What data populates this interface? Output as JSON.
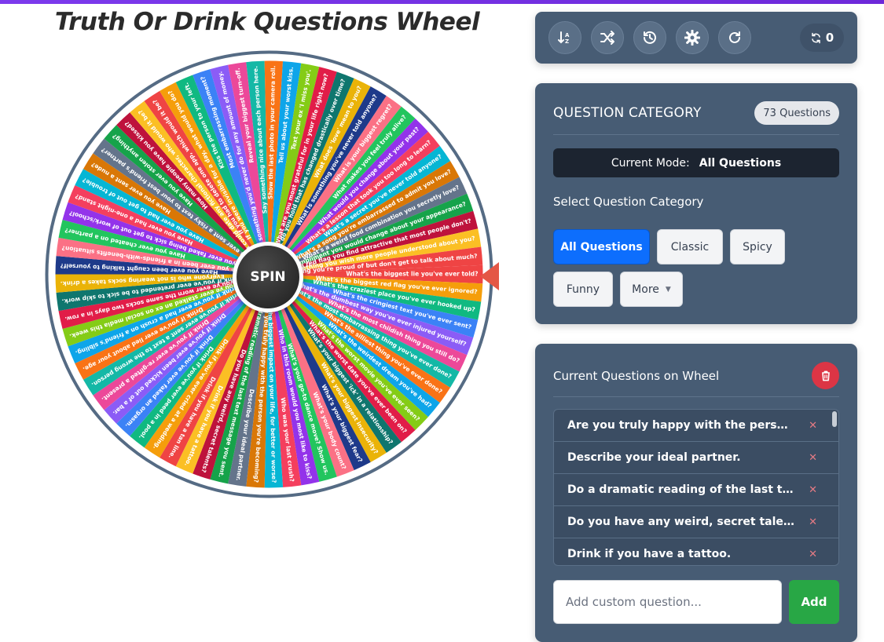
{
  "title": "Truth Or Drink Questions Wheel",
  "spin_label": "SPIN",
  "toolbar": {
    "buttons": [
      {
        "name": "sort-icon"
      },
      {
        "name": "shuffle-icon"
      },
      {
        "name": "history-icon"
      },
      {
        "name": "settings-icon"
      },
      {
        "name": "redo-icon"
      }
    ],
    "spin_count": "0"
  },
  "category_panel": {
    "title": "QUESTION CATEGORY",
    "question_count": "73 Questions",
    "mode_label": "Current Mode:",
    "mode_value": "All Questions",
    "select_label": "Select Question Category",
    "chips": [
      "All Questions",
      "Classic",
      "Spicy",
      "Funny",
      "More"
    ],
    "active_chip": "All Questions"
  },
  "current_panel": {
    "title": "Current Questions on Wheel",
    "questions": [
      "Are you truly happy with the person you're with?",
      "Describe your ideal partner.",
      "Do a dramatic reading of the last text you sent.",
      "Do you have any weird, secret talents?",
      "Drink if you have a tattoo."
    ],
    "input_placeholder": "Add custom question...",
    "add_label": "Add"
  },
  "wheel": {
    "colors": [
      "#ef4444",
      "#f59e0b",
      "#10b981",
      "#3b82f6",
      "#8b5cf6",
      "#ec4899",
      "#14b8a6",
      "#f97316",
      "#0ea5e9",
      "#84cc16",
      "#e11d48",
      "#0f766e",
      "#eab308",
      "#1e3a8a",
      "#fb7185",
      "#22c55e",
      "#9333ea",
      "#f43f5e",
      "#06b6d4",
      "#d97706",
      "#64748b",
      "#16a34a",
      "#be123c",
      "#fbbf24"
    ],
    "rim_color": "#556b84",
    "segments": [
      "What's the biggest lie you've ever told?",
      "What's the biggest red flag you've ever ignored?",
      "What's the craziest place you've ever hooked up?",
      "What's the cringiest text you've ever sent?",
      "What's the dumbest way you've ever injured yourself?",
      "What's the most childish thing you still do?",
      "What's the most embarrassing thing you've ever done?",
      "What's the silliest thing you've ever done?",
      "What's the weirdest dream you've had?",
      "What's the worst movie you've ever seen?",
      "What's the worst date you've ever been on?",
      "What's your biggest 'ick' in a relationship?",
      "What's your biggest insecurity?",
      "What's your biggest fear?",
      "What's your body count?",
      "What's your go-to dance move? Show us.",
      "Who in this room would you most like to kiss?",
      "Who was your last crush?",
      "Who's had the biggest impact on your life, for better or worse?",
      "Are you truly happy with the person you're becoming?",
      "Describe your ideal partner.",
      "Do a dramatic reading of the last text message you sent.",
      "Do you have any weird, secret talents?",
      "Drink if you have a tattoo.",
      "Drink if you have a tan line.",
      "Drink if you've ever cried at a wedding.",
      "Drink if you've ever peed in a pool.",
      "Drink if you've ever faked an orgasm.",
      "Drink if you've ever been kicked out of a bar.",
      "Drink if you've ever re-gifted a present.",
      "Drink if you've ever sent a text to the wrong person.",
      "Drink if you've ever lied about your age.",
      "Drink if you've ever had a crush on a friend's sibling.",
      "Drink if you've ever stalked an ex on social media this week.",
      "Drink if you've ever worn the same socks two days in a row.",
      "Drink if you've ever pretended to be sick to skip work.",
      "Everyone who is not wearing socks takes a drink.",
      "Have you ever been caught talking to yourself?",
      "Have you ever been in a friends-with-benefits situation?",
      "Have you ever cheated on a partner?",
      "Have you ever faked being sick to get out of work/school?",
      "Have you ever had a one-night stand?",
      "Have you ever had to get out of trouble?",
      "Have you ever sent a nude?",
      "Have you ever sent a risky text to your best friend's partner?",
      "Have you ever stolen anything?",
      "How many people have you kissed?",
      "If you could date any fictional character, who would it be?",
      "If you had to delete one app, which would it be?",
      "If you were invisible for a day, what would you do?",
      "Kiss the person to your left.",
      "Most embarrassing moment?",
      "Name something you'd never do for any amount of money.",
      "Reveal your biggest turn-off.",
      "Say something nice about each person here.",
      "Show the last photo in your camera roll.",
      "Tell us about your worst kiss.",
      "Text your ex 'I miss you'.",
      "What are you most grateful for in your life right now?",
      "What do you hold that has changed drastically over time?",
      "What does 'love' mean to you?",
      "What is something you've never told anyone?",
      "What is your biggest regret?",
      "What makes you feel truly alive?",
      "What would you change about your past?",
      "What's a lesson that took you too long to learn?",
      "What's a secret you've never told anyone?",
      "What's a song you're embarrassed to admit you love?",
      "What's a weird food combination you secretly love?",
      "What's a compliment you would change about your appearance?",
      "What's a red flag you find attractive that most people don't?",
      "What's something you wish more people understood about you?",
      "What's something you're proud of but don't get to talk about much?"
    ]
  }
}
